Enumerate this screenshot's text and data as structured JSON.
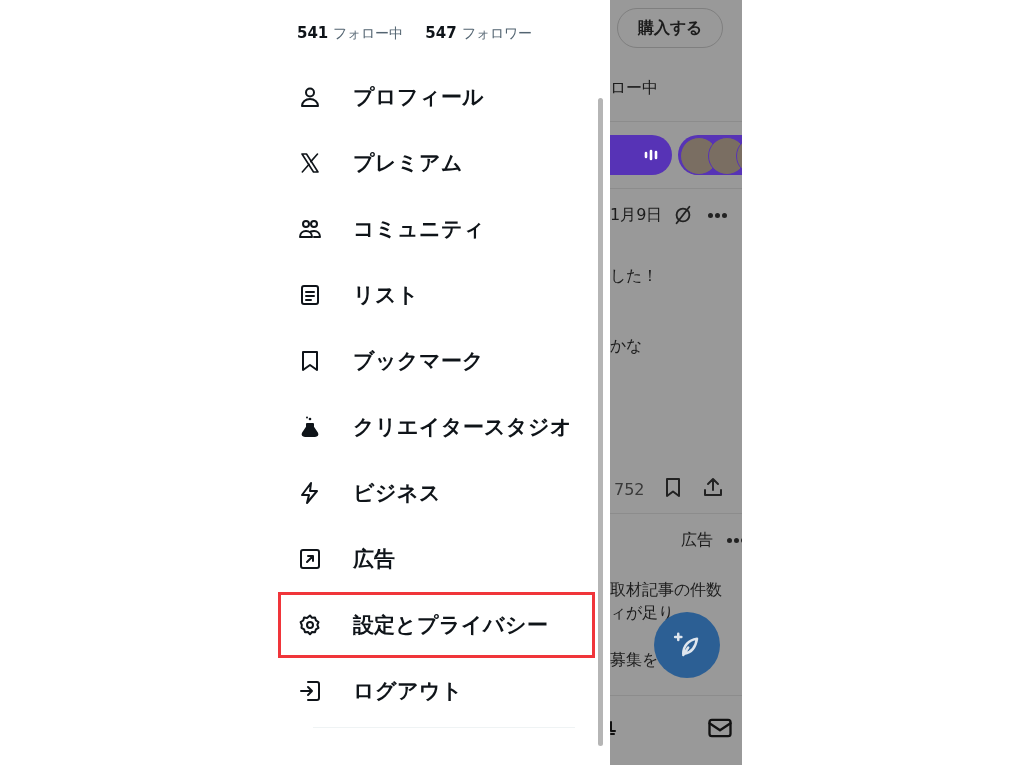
{
  "drawer": {
    "stats": [
      {
        "count": "541",
        "label": "フォロー中"
      },
      {
        "count": "547",
        "label": "フォロワー"
      }
    ],
    "menu": [
      {
        "label": "プロフィール",
        "highlighted": false
      },
      {
        "label": "プレミアム",
        "highlighted": false
      },
      {
        "label": "コミュニティ",
        "highlighted": false
      },
      {
        "label": "リスト",
        "highlighted": false
      },
      {
        "label": "ブックマーク",
        "highlighted": false
      },
      {
        "label": "クリエイタースタジオ",
        "highlighted": false
      },
      {
        "label": "ビジネス",
        "highlighted": false
      },
      {
        "label": "広告",
        "highlighted": false
      },
      {
        "label": "設定とプライバシー",
        "highlighted": true
      },
      {
        "label": "ログアウト",
        "highlighted": false
      }
    ]
  },
  "background": {
    "buy_button": "購入する",
    "following_text": "ロー中",
    "post_date": "1月9日",
    "post_lines": [
      "した！",
      "かな"
    ],
    "post_count": "752",
    "ad_label": "広告",
    "ad_lines": [
      "取材記事の件数",
      "ィが足り",
      "募集を"
    ]
  }
}
